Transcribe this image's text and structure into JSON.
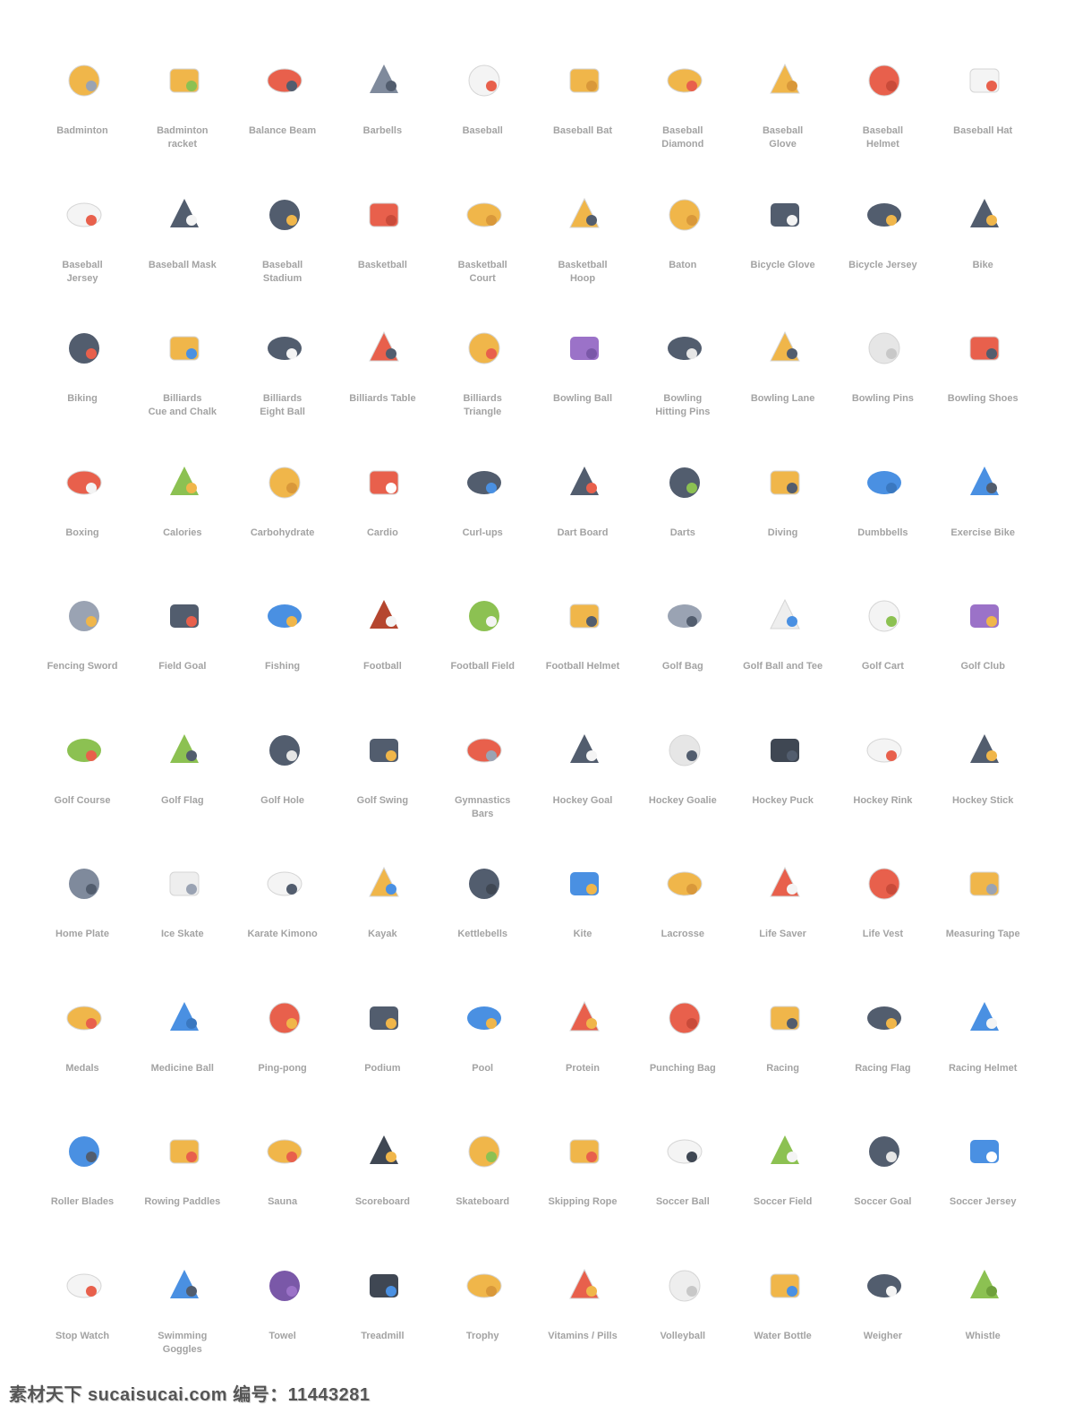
{
  "icons": [
    {
      "label": "Badminton",
      "icon": "shuttlecock-icon",
      "color": "#f0b64a",
      "alt": "#9aa3b3"
    },
    {
      "label": "Badminton\nracket",
      "icon": "badminton-racket-icon",
      "color": "#f0b64a",
      "alt": "#8cc152"
    },
    {
      "label": "Balance Beam",
      "icon": "balance-beam-icon",
      "color": "#e8604c",
      "alt": "#525d6e"
    },
    {
      "label": "Barbells",
      "icon": "barbell-icon",
      "color": "#7f8a9c",
      "alt": "#525d6e"
    },
    {
      "label": "Baseball",
      "icon": "baseball-icon",
      "color": "#f4f4f4",
      "alt": "#e8604c"
    },
    {
      "label": "Baseball Bat",
      "icon": "baseball-bat-icon",
      "color": "#f0b64a",
      "alt": "#d9983a"
    },
    {
      "label": "Baseball\nDiamond",
      "icon": "baseball-diamond-icon",
      "color": "#f0b64a",
      "alt": "#e8604c"
    },
    {
      "label": "Baseball\nGlove",
      "icon": "baseball-glove-icon",
      "color": "#f0b64a",
      "alt": "#d9983a"
    },
    {
      "label": "Baseball\nHelmet",
      "icon": "baseball-helmet-icon",
      "color": "#e8604c",
      "alt": "#c94b3a"
    },
    {
      "label": "Baseball Hat",
      "icon": "baseball-hat-icon",
      "color": "#f4f4f4",
      "alt": "#e8604c"
    },
    {
      "label": "Baseball\nJersey",
      "icon": "baseball-jersey-icon",
      "color": "#f4f4f4",
      "alt": "#e8604c"
    },
    {
      "label": "Baseball Mask",
      "icon": "baseball-mask-icon",
      "color": "#525d6e",
      "alt": "#f4f4f4"
    },
    {
      "label": "Baseball\nStadium",
      "icon": "baseball-stadium-icon",
      "color": "#525d6e",
      "alt": "#f0b64a"
    },
    {
      "label": "Basketball",
      "icon": "basketball-icon",
      "color": "#e8604c",
      "alt": "#c94b3a"
    },
    {
      "label": "Basketball\nCourt",
      "icon": "basketball-court-icon",
      "color": "#f0b64a",
      "alt": "#d9983a"
    },
    {
      "label": "Basketball\nHoop",
      "icon": "basketball-hoop-icon",
      "color": "#f0b64a",
      "alt": "#525d6e"
    },
    {
      "label": "Baton",
      "icon": "baton-icon",
      "color": "#f0b64a",
      "alt": "#d9983a"
    },
    {
      "label": "Bicycle Glove",
      "icon": "bicycle-glove-icon",
      "color": "#525d6e",
      "alt": "#f4f4f4"
    },
    {
      "label": "Bicycle Jersey",
      "icon": "bicycle-jersey-icon",
      "color": "#525d6e",
      "alt": "#f0b64a"
    },
    {
      "label": "Bike",
      "icon": "bike-icon",
      "color": "#525d6e",
      "alt": "#f0b64a"
    },
    {
      "label": "Biking",
      "icon": "biking-icon",
      "color": "#525d6e",
      "alt": "#e8604c"
    },
    {
      "label": "Billiards\nCue and Chalk",
      "icon": "billiards-cue-icon",
      "color": "#f0b64a",
      "alt": "#4a90e2"
    },
    {
      "label": "Billiards\nEight Ball",
      "icon": "eight-ball-icon",
      "color": "#525d6e",
      "alt": "#f4f4f4"
    },
    {
      "label": "Billiards Table",
      "icon": "billiards-table-icon",
      "color": "#e8604c",
      "alt": "#525d6e"
    },
    {
      "label": "Billiards\nTriangle",
      "icon": "billiards-triangle-icon",
      "color": "#f0b64a",
      "alt": "#e8604c"
    },
    {
      "label": "Bowling Ball",
      "icon": "bowling-ball-icon",
      "color": "#9b72c8",
      "alt": "#7a58a8"
    },
    {
      "label": "Bowling\nHitting Pins",
      "icon": "bowling-hitting-pins-icon",
      "color": "#525d6e",
      "alt": "#e6e6e6"
    },
    {
      "label": "Bowling Lane",
      "icon": "bowling-lane-icon",
      "color": "#f0b64a",
      "alt": "#525d6e"
    },
    {
      "label": "Bowling Pins",
      "icon": "bowling-pins-icon",
      "color": "#e6e6e6",
      "alt": "#c8c8c8"
    },
    {
      "label": "Bowling Shoes",
      "icon": "bowling-shoes-icon",
      "color": "#e8604c",
      "alt": "#525d6e"
    },
    {
      "label": "Boxing",
      "icon": "boxing-glove-icon",
      "color": "#e8604c",
      "alt": "#f4f4f4"
    },
    {
      "label": "Calories",
      "icon": "calories-icon",
      "color": "#8cc152",
      "alt": "#f0b64a"
    },
    {
      "label": "Carbohydrate",
      "icon": "wheat-icon",
      "color": "#f0b64a",
      "alt": "#d9983a"
    },
    {
      "label": "Cardio",
      "icon": "heart-icon",
      "color": "#e8604c",
      "alt": "#ffffff"
    },
    {
      "label": "Curl-ups",
      "icon": "curl-ups-icon",
      "color": "#525d6e",
      "alt": "#4a90e2"
    },
    {
      "label": "Dart Board",
      "icon": "dart-board-icon",
      "color": "#525d6e",
      "alt": "#e8604c"
    },
    {
      "label": "Darts",
      "icon": "darts-icon",
      "color": "#525d6e",
      "alt": "#8cc152"
    },
    {
      "label": "Diving",
      "icon": "diving-mask-icon",
      "color": "#f0b64a",
      "alt": "#525d6e"
    },
    {
      "label": "Dumbbells",
      "icon": "dumbbell-icon",
      "color": "#4a90e2",
      "alt": "#3a78c0"
    },
    {
      "label": "Exercise Bike",
      "icon": "exercise-bike-icon",
      "color": "#4a90e2",
      "alt": "#525d6e"
    },
    {
      "label": "Fencing Sword",
      "icon": "fencing-sword-icon",
      "color": "#9aa3b3",
      "alt": "#f0b64a"
    },
    {
      "label": "Field Goal",
      "icon": "field-goal-icon",
      "color": "#525d6e",
      "alt": "#e8604c"
    },
    {
      "label": "Fishing",
      "icon": "fishing-icon",
      "color": "#4a90e2",
      "alt": "#f0b64a"
    },
    {
      "label": "Football",
      "icon": "football-icon",
      "color": "#b5462f",
      "alt": "#f4f4f4"
    },
    {
      "label": "Football Field",
      "icon": "football-field-icon",
      "color": "#8cc152",
      "alt": "#f4f4f4"
    },
    {
      "label": "Football Helmet",
      "icon": "football-helmet-icon",
      "color": "#f0b64a",
      "alt": "#525d6e"
    },
    {
      "label": "Golf Bag",
      "icon": "golf-bag-icon",
      "color": "#9aa3b3",
      "alt": "#525d6e"
    },
    {
      "label": "Golf Ball and Tee",
      "icon": "golf-ball-tee-icon",
      "color": "#eeeeee",
      "alt": "#4a90e2"
    },
    {
      "label": "Golf Cart",
      "icon": "golf-cart-icon",
      "color": "#f4f4f4",
      "alt": "#8cc152"
    },
    {
      "label": "Golf Club",
      "icon": "golf-club-crest-icon",
      "color": "#9b72c8",
      "alt": "#f0b64a"
    },
    {
      "label": "Golf Course",
      "icon": "golf-course-icon",
      "color": "#8cc152",
      "alt": "#e8604c"
    },
    {
      "label": "Golf Flag",
      "icon": "golf-flag-icon",
      "color": "#8cc152",
      "alt": "#525d6e"
    },
    {
      "label": "Golf Hole",
      "icon": "golf-hole-icon",
      "color": "#525d6e",
      "alt": "#e6e6e6"
    },
    {
      "label": "Golf Swing",
      "icon": "golf-swing-icon",
      "color": "#525d6e",
      "alt": "#f0b64a"
    },
    {
      "label": "Gymnastics\nBars",
      "icon": "gymnastics-bars-icon",
      "color": "#e8604c",
      "alt": "#9aa3b3"
    },
    {
      "label": "Hockey Goal",
      "icon": "hockey-goal-icon",
      "color": "#525d6e",
      "alt": "#f4f4f4"
    },
    {
      "label": "Hockey Goalie",
      "icon": "hockey-goalie-mask-icon",
      "color": "#e6e6e6",
      "alt": "#525d6e"
    },
    {
      "label": "Hockey Puck",
      "icon": "hockey-puck-icon",
      "color": "#3f4753",
      "alt": "#525d6e"
    },
    {
      "label": "Hockey Rink",
      "icon": "hockey-rink-icon",
      "color": "#f4f4f4",
      "alt": "#e8604c"
    },
    {
      "label": "Hockey Stick",
      "icon": "hockey-stick-icon",
      "color": "#525d6e",
      "alt": "#f0b64a"
    },
    {
      "label": "Home Plate",
      "icon": "home-plate-icon",
      "color": "#7f8a9c",
      "alt": "#525d6e"
    },
    {
      "label": "Ice Skate",
      "icon": "ice-skate-icon",
      "color": "#eeeeee",
      "alt": "#9aa3b3"
    },
    {
      "label": "Karate Kimono",
      "icon": "kimono-icon",
      "color": "#f4f4f4",
      "alt": "#525d6e"
    },
    {
      "label": "Kayak",
      "icon": "kayak-icon",
      "color": "#f0b64a",
      "alt": "#4a90e2"
    },
    {
      "label": "Kettlebells",
      "icon": "kettlebell-icon",
      "color": "#525d6e",
      "alt": "#3f4753"
    },
    {
      "label": "Kite",
      "icon": "kite-icon",
      "color": "#4a90e2",
      "alt": "#f0b64a"
    },
    {
      "label": "Lacrosse",
      "icon": "lacrosse-stick-icon",
      "color": "#f0b64a",
      "alt": "#d9983a"
    },
    {
      "label": "Life Saver",
      "icon": "life-saver-icon",
      "color": "#e8604c",
      "alt": "#f4f4f4"
    },
    {
      "label": "Life Vest",
      "icon": "life-vest-icon",
      "color": "#e8604c",
      "alt": "#c94b3a"
    },
    {
      "label": "Measuring Tape",
      "icon": "measuring-tape-icon",
      "color": "#f0b64a",
      "alt": "#9aa3b3"
    },
    {
      "label": "Medals",
      "icon": "medal-icon",
      "color": "#f0b64a",
      "alt": "#e8604c"
    },
    {
      "label": "Medicine Ball",
      "icon": "medicine-ball-icon",
      "color": "#4a90e2",
      "alt": "#3a78c0"
    },
    {
      "label": "Ping-pong",
      "icon": "ping-pong-icon",
      "color": "#e8604c",
      "alt": "#f0b64a"
    },
    {
      "label": "Podium",
      "icon": "podium-icon",
      "color": "#525d6e",
      "alt": "#f0b64a"
    },
    {
      "label": "Pool",
      "icon": "pool-icon",
      "color": "#4a90e2",
      "alt": "#f0b64a"
    },
    {
      "label": "Protein",
      "icon": "protein-icon",
      "color": "#e8604c",
      "alt": "#f0b64a"
    },
    {
      "label": "Punching Bag",
      "icon": "punching-bag-icon",
      "color": "#e8604c",
      "alt": "#c94b3a"
    },
    {
      "label": "Racing",
      "icon": "racing-car-icon",
      "color": "#f0b64a",
      "alt": "#525d6e"
    },
    {
      "label": "Racing Flag",
      "icon": "racing-flag-icon",
      "color": "#525d6e",
      "alt": "#f0b64a"
    },
    {
      "label": "Racing Helmet",
      "icon": "racing-helmet-icon",
      "color": "#4a90e2",
      "alt": "#f4f4f4"
    },
    {
      "label": "Roller Blades",
      "icon": "roller-blade-icon",
      "color": "#4a90e2",
      "alt": "#525d6e"
    },
    {
      "label": "Rowing Paddles",
      "icon": "rowing-paddles-icon",
      "color": "#f0b64a",
      "alt": "#e8604c"
    },
    {
      "label": "Sauna",
      "icon": "sauna-bucket-icon",
      "color": "#f0b64a",
      "alt": "#e8604c"
    },
    {
      "label": "Scoreboard",
      "icon": "scoreboard-icon",
      "color": "#3f4753",
      "alt": "#f0b64a"
    },
    {
      "label": "Skateboard",
      "icon": "skateboard-icon",
      "color": "#f0b64a",
      "alt": "#8cc152"
    },
    {
      "label": "Skipping Rope",
      "icon": "skipping-rope-icon",
      "color": "#f0b64a",
      "alt": "#e8604c"
    },
    {
      "label": "Soccer Ball",
      "icon": "soccer-ball-icon",
      "color": "#f4f4f4",
      "alt": "#3f4753"
    },
    {
      "label": "Soccer Field",
      "icon": "soccer-field-icon",
      "color": "#8cc152",
      "alt": "#f4f4f4"
    },
    {
      "label": "Soccer Goal",
      "icon": "soccer-goal-icon",
      "color": "#525d6e",
      "alt": "#e6e6e6"
    },
    {
      "label": "Soccer Jersey",
      "icon": "soccer-jersey-icon",
      "color": "#4a90e2",
      "alt": "#ffffff"
    },
    {
      "label": "Stop Watch",
      "icon": "stopwatch-icon",
      "color": "#f4f4f4",
      "alt": "#e8604c"
    },
    {
      "label": "Swimming\nGoggles",
      "icon": "swimming-goggles-icon",
      "color": "#4a90e2",
      "alt": "#525d6e"
    },
    {
      "label": "Towel",
      "icon": "towel-icon",
      "color": "#7a58a8",
      "alt": "#9b72c8"
    },
    {
      "label": "Treadmill",
      "icon": "treadmill-icon",
      "color": "#3f4753",
      "alt": "#4a90e2"
    },
    {
      "label": "Trophy",
      "icon": "trophy-icon",
      "color": "#f0b64a",
      "alt": "#d9983a"
    },
    {
      "label": "Vitamins / Pills",
      "icon": "pills-icon",
      "color": "#e8604c",
      "alt": "#f0b64a"
    },
    {
      "label": "Volleyball",
      "icon": "volleyball-icon",
      "color": "#eeeeee",
      "alt": "#c8c8c8"
    },
    {
      "label": "Water Bottle",
      "icon": "water-bottle-icon",
      "color": "#f0b64a",
      "alt": "#4a90e2"
    },
    {
      "label": "Weigher",
      "icon": "scale-icon",
      "color": "#525d6e",
      "alt": "#f4f4f4"
    },
    {
      "label": "Whistle",
      "icon": "whistle-icon",
      "color": "#8cc152",
      "alt": "#6fa03c"
    }
  ],
  "watermark": "素材天下 sucaisucai.com  编号：11443281"
}
